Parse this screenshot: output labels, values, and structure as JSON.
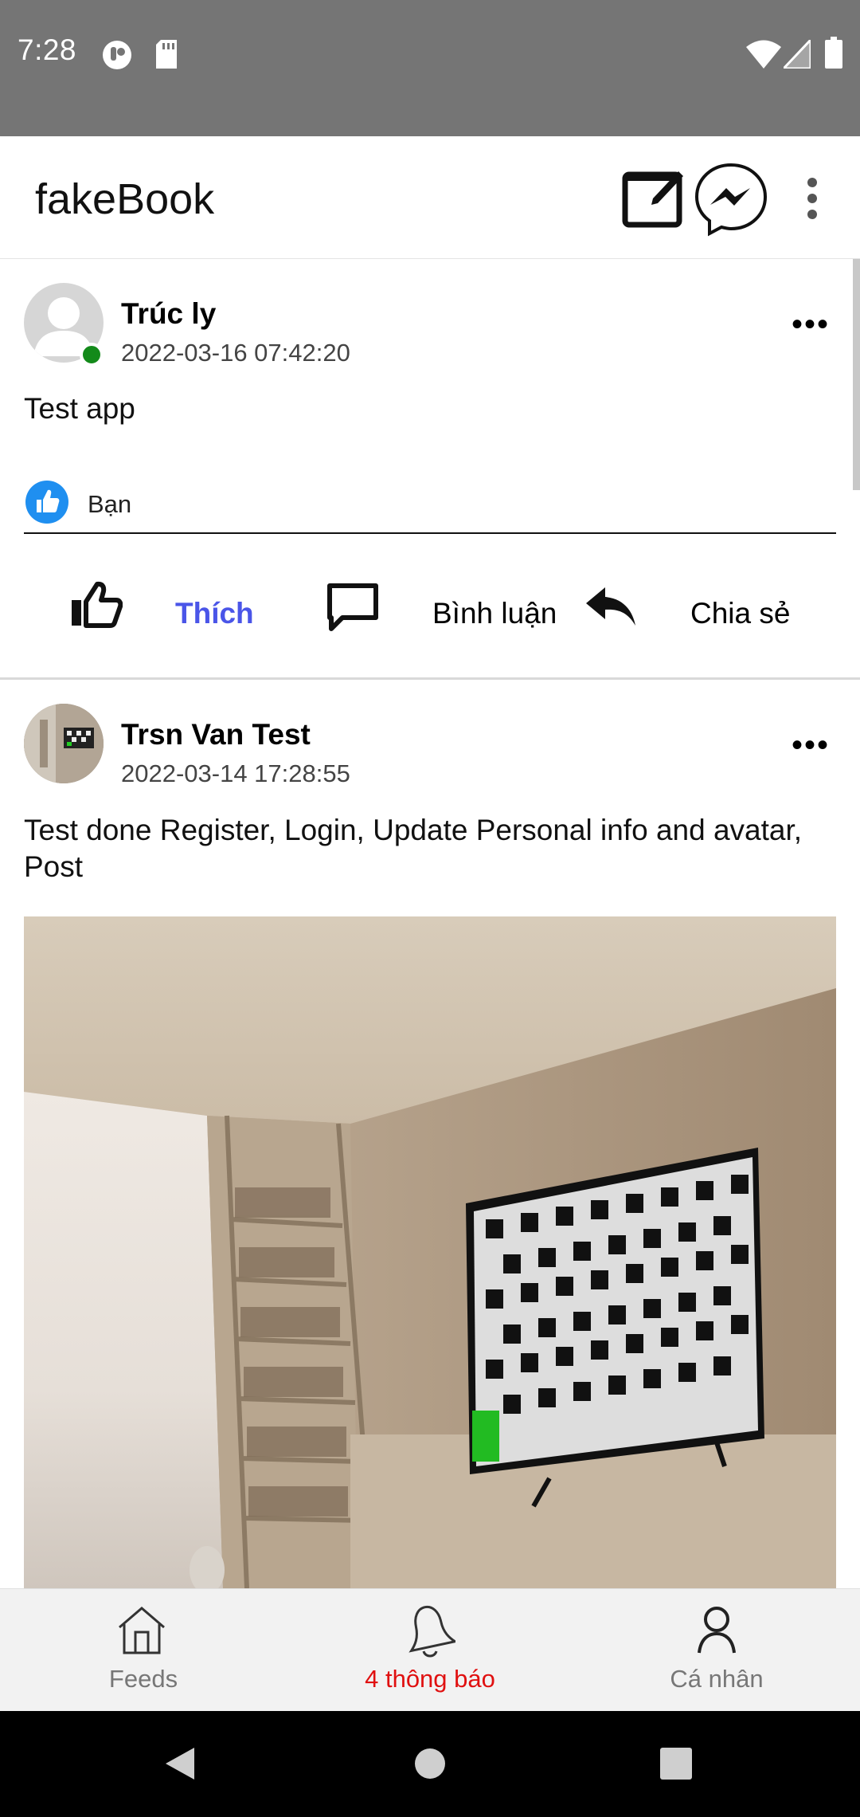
{
  "status_bar": {
    "time": "7:28"
  },
  "app_bar": {
    "title": "fakeBook"
  },
  "posts": [
    {
      "author": "Trúc ly",
      "timestamp": "2022-03-16 07:42:20",
      "text": "Test app",
      "like_summary": "Bạn",
      "actions": {
        "like": "Thích",
        "comment": "Bình luận",
        "share": "Chia sẻ"
      },
      "liked_color": "#4a55e8"
    },
    {
      "author": "Trsn Van Test",
      "timestamp": "2022-03-14 17:28:55",
      "text": "Test done Register, Login, Update Personal info and avatar, Post"
    }
  ],
  "bottom_nav": {
    "items": [
      {
        "label": "Feeds",
        "icon": "home-icon"
      },
      {
        "label": "4 thông báo",
        "icon": "bell-icon",
        "active": true,
        "color": "#e01010"
      },
      {
        "label": "Cá nhân",
        "icon": "person-icon"
      }
    ]
  },
  "colors": {
    "accent_blue": "#4a55e8",
    "online_green": "#138a1a",
    "notification_red": "#e01010"
  }
}
